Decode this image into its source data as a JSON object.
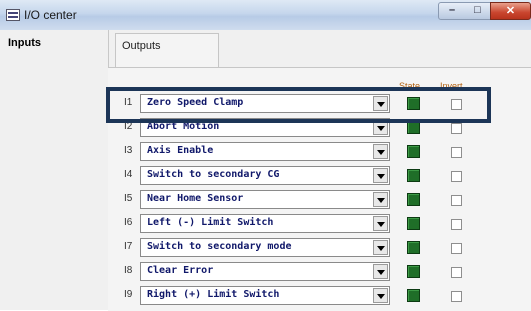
{
  "window": {
    "title": "I/O center",
    "controls": {
      "minimize": "–",
      "maximize": "□",
      "close": "✕"
    }
  },
  "tabs": {
    "inputs": "Inputs",
    "outputs": "Outputs"
  },
  "columns": {
    "state": "State",
    "invert": "Invert"
  },
  "rows": [
    {
      "num": "I1",
      "label": "Zero Speed Clamp",
      "state": "active",
      "inverted": false
    },
    {
      "num": "I2",
      "label": "Abort Motion",
      "state": "active",
      "inverted": false
    },
    {
      "num": "I3",
      "label": "Axis Enable",
      "state": "active",
      "inverted": false
    },
    {
      "num": "I4",
      "label": "Switch to secondary CG",
      "state": "active",
      "inverted": false
    },
    {
      "num": "I5",
      "label": "Near Home Sensor",
      "state": "active",
      "inverted": false
    },
    {
      "num": "I6",
      "label": "Left (-) Limit Switch",
      "state": "active",
      "inverted": false
    },
    {
      "num": "I7",
      "label": "Switch to secondary mode",
      "state": "active",
      "inverted": false
    },
    {
      "num": "I8",
      "label": "Clear Error",
      "state": "active",
      "inverted": false
    },
    {
      "num": "I9",
      "label": "Right (+) Limit Switch",
      "state": "active",
      "inverted": false
    }
  ],
  "colors": {
    "led_on": "#1f6e28",
    "highlight": "#1c3557",
    "combo_text": "#10186a",
    "header_text": "#b06010"
  }
}
